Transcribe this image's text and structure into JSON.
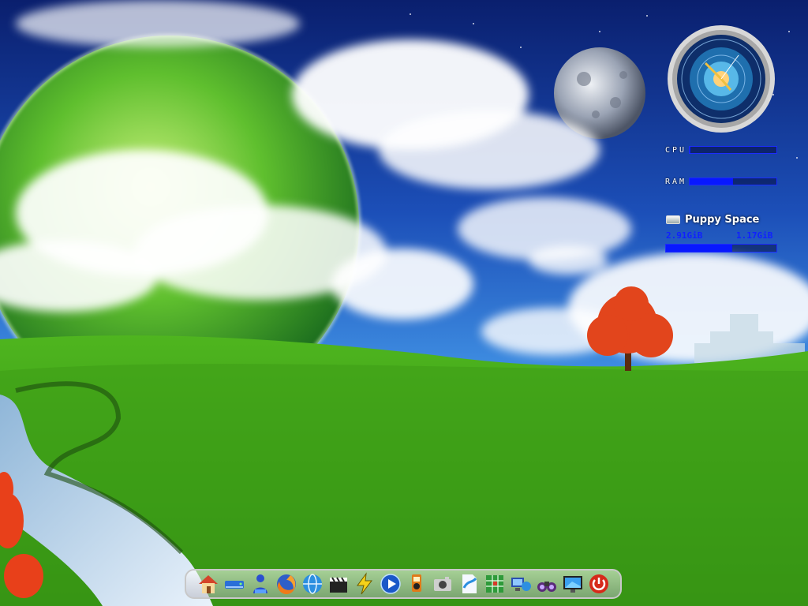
{
  "desktop": {
    "widgets": {
      "cpu": {
        "label": "CPU",
        "usage_fraction": 0.01
      },
      "ram": {
        "label": "RAM",
        "usage_fraction": 0.5
      },
      "space": {
        "title": "Puppy Space",
        "used": "2.91GiB",
        "free": "1.17GiB",
        "usage_fraction": 0.6,
        "icon": "drive-icon"
      },
      "clock": {
        "icon": "zodiac-clock-icon"
      }
    },
    "colors": {
      "meter_fill": "#0818ff",
      "meter_border": "#1c2cff",
      "space_text": "#1020ff"
    },
    "dock": {
      "items": [
        {
          "name": "home",
          "icon": "home-icon"
        },
        {
          "name": "drive",
          "icon": "drive-icon"
        },
        {
          "name": "installer",
          "icon": "installer-icon"
        },
        {
          "name": "firefox",
          "icon": "firefox-icon"
        },
        {
          "name": "browser",
          "icon": "globe-icon"
        },
        {
          "name": "video-editor",
          "icon": "clapperboard-icon"
        },
        {
          "name": "lightning",
          "icon": "lightning-icon"
        },
        {
          "name": "media-player",
          "icon": "play-icon"
        },
        {
          "name": "music-player",
          "icon": "music-player-icon"
        },
        {
          "name": "camera",
          "icon": "camera-icon"
        },
        {
          "name": "document",
          "icon": "document-icon"
        },
        {
          "name": "spreadsheet",
          "icon": "spreadsheet-icon"
        },
        {
          "name": "network",
          "icon": "network-icon"
        },
        {
          "name": "search",
          "icon": "binoculars-icon"
        },
        {
          "name": "display",
          "icon": "monitor-icon"
        },
        {
          "name": "power",
          "icon": "power-icon"
        }
      ]
    }
  }
}
